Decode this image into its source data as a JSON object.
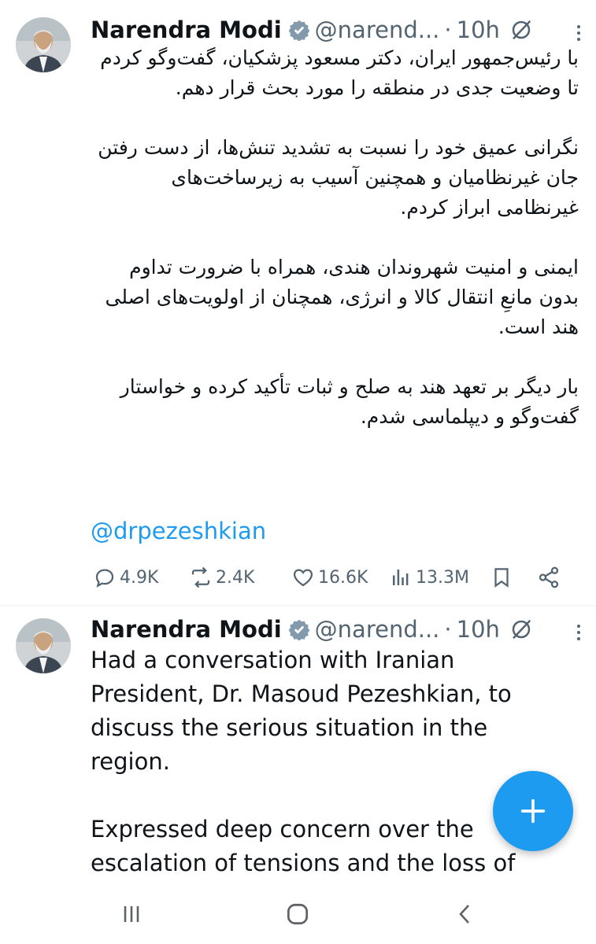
{
  "colors": {
    "accent": "#1d9bf0",
    "text": "#0f1419",
    "muted": "#536471"
  },
  "tweets": [
    {
      "author": "Narendra Modi",
      "handle": "@narend...",
      "separator": "·",
      "time": "10h",
      "verified_icon": "verified-badge-icon",
      "paragraphs": [
        "با رئیس‌جمهور ایران، دکتر مسعود پزشکیان، گفت‌وگو کردم تا وضعیت جدی در منطقه را مورد بحث قرار دهم.",
        "نگرانی عمیق خود را نسبت به تشدید تنش‌ها، از دست رفتن جان غیرنظامیان و همچنین آسیب به زیرساخت‌های غیرنظامی ابراز کردم.",
        "ایمنی و امنیت شهروندان هندی، همراه با ضرورت تداوم بدون مانعِ انتقال کالا و انرژی، همچنان از اولویت‌های اصلی هند است.",
        "بار دیگر بر تعهد هند به صلح و ثبات تأکید کرده و خواستار گفت‌وگو و دیپلماسی شدم."
      ],
      "mention": "@drpezeshkian",
      "stats": {
        "replies": "4.9K",
        "reposts": "2.4K",
        "likes": "16.6K",
        "views": "13.3M"
      }
    },
    {
      "author": "Narendra Modi",
      "handle": "@narend...",
      "separator": "·",
      "time": "10h",
      "verified_icon": "verified-badge-icon",
      "paragraphs": [
        "Had a conversation with Iranian President, Dr. Masoud Pezeshkian, to discuss the serious situation in the region.",
        "Expressed deep concern over the escalation of tensions and the loss of"
      ]
    }
  ],
  "fab": {
    "icon": "plus-icon"
  },
  "navbar": {
    "icons": [
      "recent-apps-icon",
      "home-icon",
      "back-icon"
    ]
  }
}
